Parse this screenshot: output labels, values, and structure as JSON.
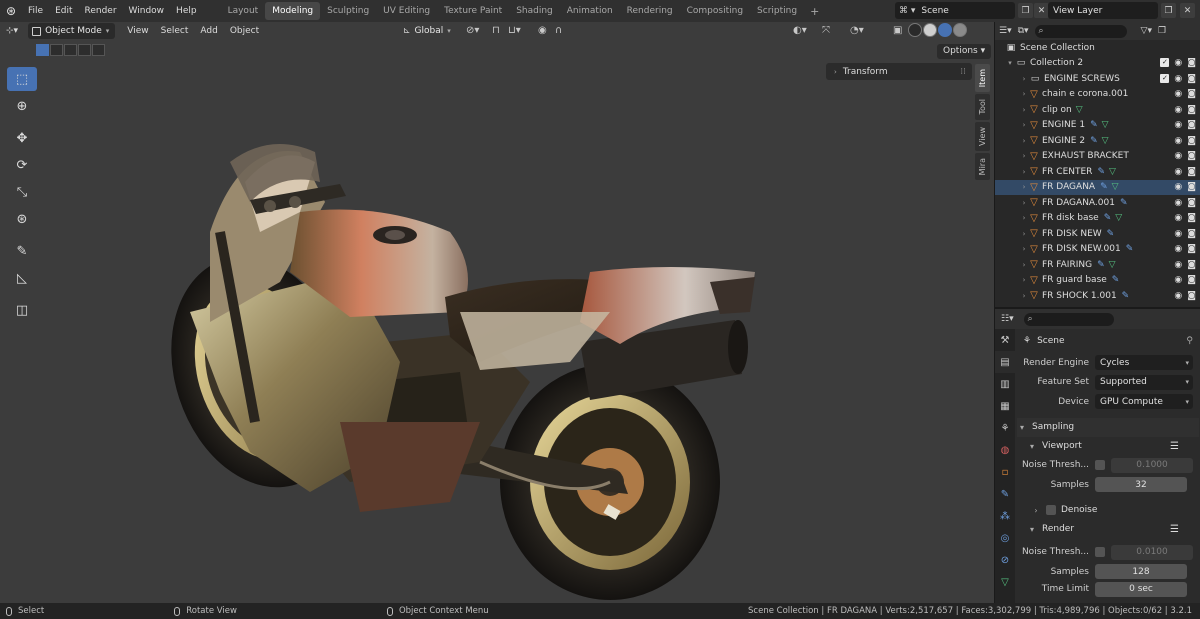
{
  "topbar": {
    "menus": [
      "File",
      "Edit",
      "Render",
      "Window",
      "Help"
    ],
    "workspaces": [
      "Layout",
      "Modeling",
      "Sculpting",
      "UV Editing",
      "Texture Paint",
      "Shading",
      "Animation",
      "Rendering",
      "Compositing",
      "Scripting"
    ],
    "active_workspace": "Modeling",
    "add_workspace": "+",
    "scene": "Scene",
    "view_layer": "View Layer"
  },
  "viewport": {
    "mode": "Object Mode",
    "menus": [
      "View",
      "Select",
      "Add",
      "Object"
    ],
    "transform_orientation": "Global",
    "options_label": "Options",
    "n_panel_tabs": [
      "Item",
      "Tool",
      "View",
      "Mira"
    ],
    "active_n_tab": "Item",
    "transform_panel": "Transform"
  },
  "outliner": {
    "scene_collection": "Scene Collection",
    "collection": "Collection 2",
    "items": [
      {
        "name": "ENGINE SCREWS",
        "type": "collection",
        "modifier": false,
        "mesh": false,
        "selected": false
      },
      {
        "name": "chain e corona.001",
        "type": "object",
        "modifier": false,
        "mesh": false,
        "selected": false
      },
      {
        "name": "clip on",
        "type": "object",
        "modifier": false,
        "mesh": true,
        "selected": false
      },
      {
        "name": "ENGINE 1",
        "type": "object",
        "modifier": true,
        "mesh": true,
        "selected": false
      },
      {
        "name": "ENGINE 2",
        "type": "object",
        "modifier": true,
        "mesh": true,
        "selected": false
      },
      {
        "name": "EXHAUST BRACKET",
        "type": "object",
        "modifier": false,
        "mesh": false,
        "selected": false
      },
      {
        "name": "FR CENTER",
        "type": "object",
        "modifier": true,
        "mesh": true,
        "selected": false
      },
      {
        "name": "FR DAGANA",
        "type": "object",
        "modifier": true,
        "mesh": true,
        "selected": true
      },
      {
        "name": "FR DAGANA.001",
        "type": "object",
        "modifier": true,
        "mesh": false,
        "selected": false
      },
      {
        "name": "FR disk base",
        "type": "object",
        "modifier": true,
        "mesh": true,
        "selected": false
      },
      {
        "name": "FR DISK NEW",
        "type": "object",
        "modifier": true,
        "mesh": false,
        "selected": false
      },
      {
        "name": "FR DISK NEW.001",
        "type": "object",
        "modifier": true,
        "mesh": false,
        "selected": false
      },
      {
        "name": "FR FAIRING",
        "type": "object",
        "modifier": true,
        "mesh": true,
        "selected": false
      },
      {
        "name": "FR guard base",
        "type": "object",
        "modifier": true,
        "mesh": false,
        "selected": false
      },
      {
        "name": "FR SHOCK 1.001",
        "type": "object",
        "modifier": true,
        "mesh": false,
        "selected": false
      }
    ]
  },
  "properties": {
    "context": "Scene",
    "render_engine": {
      "label": "Render Engine",
      "value": "Cycles"
    },
    "feature_set": {
      "label": "Feature Set",
      "value": "Supported"
    },
    "device": {
      "label": "Device",
      "value": "GPU Compute"
    },
    "sampling": "Sampling",
    "viewport_section": "Viewport",
    "viewport_noise": {
      "label": "Noise Thresh...",
      "value": "0.1000"
    },
    "viewport_samples": {
      "label": "Samples",
      "value": "32"
    },
    "denoise": "Denoise",
    "render_section": "Render",
    "render_noise": {
      "label": "Noise Thresh...",
      "value": "0.0100"
    },
    "render_samples": {
      "label": "Samples",
      "value": "128"
    },
    "time_limit": {
      "label": "Time Limit",
      "value": "0 sec"
    }
  },
  "statusbar": {
    "select": "Select",
    "rotate": "Rotate View",
    "context_menu": "Object Context Menu",
    "info": "Scene Collection | FR DAGANA | Verts:2,517,657 | Faces:3,302,799 | Tris:4,989,796 | Objects:0/62 | 3.2.1"
  },
  "colors": {
    "accent": "#4772b3",
    "object_icon": "#e08a3c",
    "modifier_icon": "#6fa0e0",
    "mesh_icon": "#55c080"
  }
}
